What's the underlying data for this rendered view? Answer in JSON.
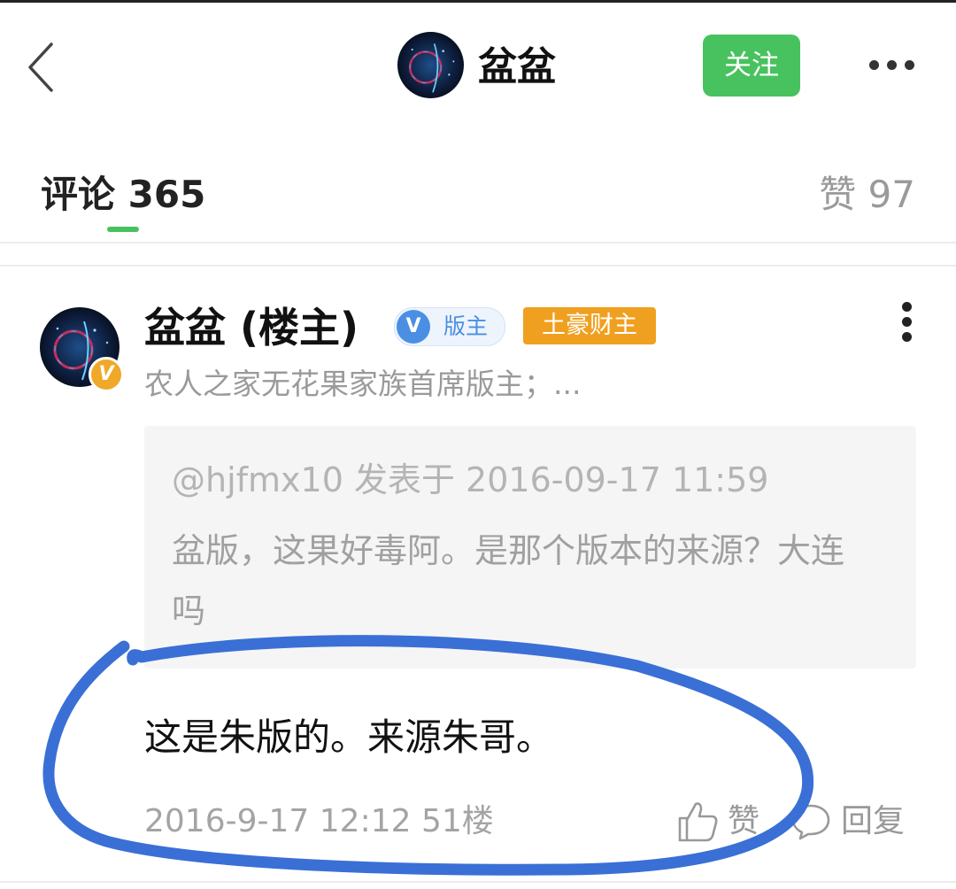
{
  "header": {
    "back_icon": "chevron-left-icon",
    "title": "盆盆",
    "follow_label": "关注",
    "more_icon": "more-horizontal-icon",
    "accent_color": "#48c25e"
  },
  "tabs": {
    "comments_label": "评论 365",
    "likes_label": "赞 97"
  },
  "comment": {
    "author": "盆盆 (楼主)",
    "verified_badge": "V",
    "moderator_badge_icon": "V",
    "moderator_badge_label": "版主",
    "rich_badge_label": "土豪财主",
    "subtitle": "农人之家无花果家族首席版主；...",
    "quote": {
      "meta": "@hjfmx10 发表于 2016-09-17 11:59",
      "text": "盆版，这果好毒阿。是那个版本的来源？大连吗"
    },
    "text": "这是朱版的。来源朱哥。",
    "timestamp": "2016-9-17 12:12  51楼",
    "like_label": "赞",
    "reply_label": "回复",
    "menu_icon": "more-vertical-icon"
  },
  "annotation": {
    "type": "hand-drawn ellipse",
    "color": "#3a6fd6"
  }
}
